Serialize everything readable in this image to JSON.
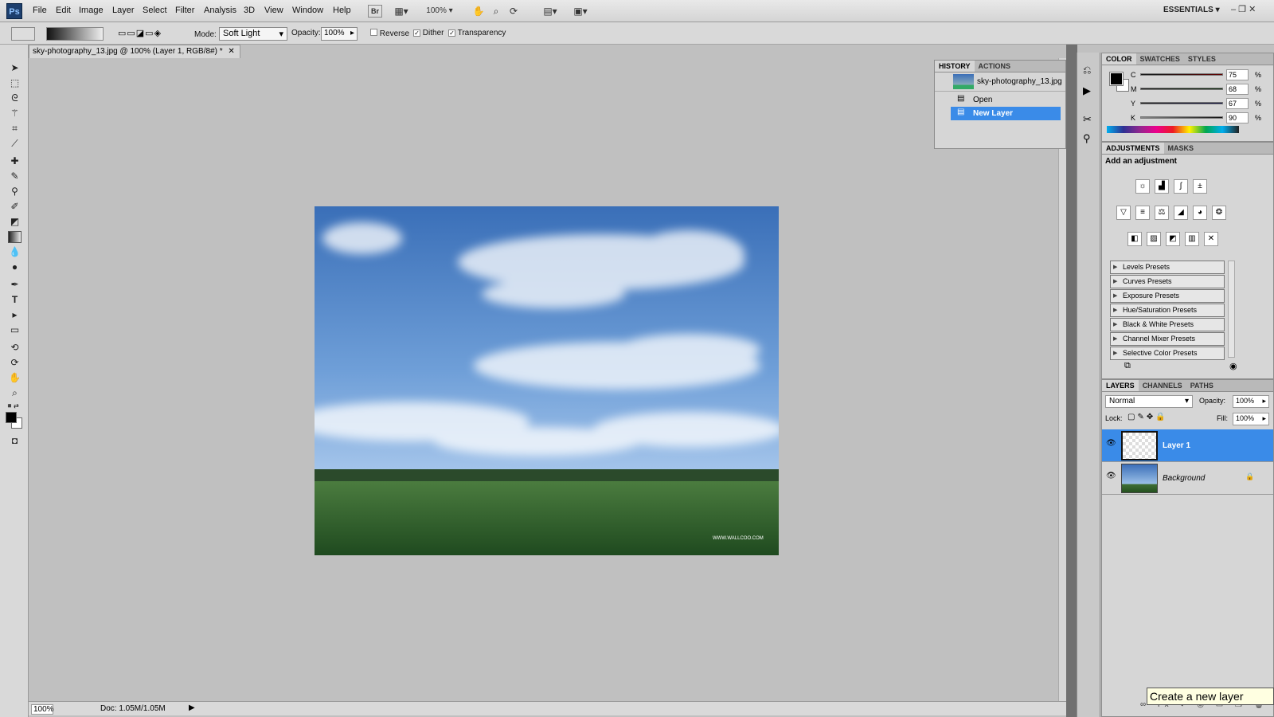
{
  "app": {
    "logo": "Ps",
    "workspace": "ESSENTIALS"
  },
  "menu": [
    "File",
    "Edit",
    "Image",
    "Layer",
    "Select",
    "Filter",
    "Analysis",
    "3D",
    "View",
    "Window",
    "Help"
  ],
  "toolbar": {
    "bridge": "Br",
    "zoom": "100%"
  },
  "options": {
    "mode_label": "Mode:",
    "mode_value": "Soft Light",
    "opacity_label": "Opacity:",
    "opacity_value": "100%",
    "reverse": "Reverse",
    "dither": "Dither",
    "transparency": "Transparency"
  },
  "document": {
    "tab_title": "sky-photography_13.jpg @ 100% (Layer 1, RGB/8#) *",
    "zoom": "100%",
    "doc_size": "Doc: 1.05M/1.05M",
    "watermark": "WWW.WALLCOO.COM"
  },
  "history": {
    "tabs": [
      "HISTORY",
      "ACTIONS"
    ],
    "snapshot": "sky-photography_13.jpg",
    "items": [
      "Open",
      "New Layer"
    ]
  },
  "color": {
    "tabs": [
      "COLOR",
      "SWATCHES",
      "STYLES"
    ],
    "channels": [
      {
        "name": "C",
        "value": "75"
      },
      {
        "name": "M",
        "value": "68"
      },
      {
        "name": "Y",
        "value": "67"
      },
      {
        "name": "K",
        "value": "90"
      }
    ],
    "unit": "%"
  },
  "adjustments": {
    "tabs": [
      "ADJUSTMENTS",
      "MASKS"
    ],
    "heading": "Add an adjustment",
    "presets": [
      "Levels Presets",
      "Curves Presets",
      "Exposure Presets",
      "Hue/Saturation Presets",
      "Black & White Presets",
      "Channel Mixer Presets",
      "Selective Color Presets"
    ]
  },
  "layers": {
    "tabs": [
      "LAYERS",
      "CHANNELS",
      "PATHS"
    ],
    "blend": "Normal",
    "opacity_label": "Opacity:",
    "opacity_value": "100%",
    "lock_label": "Lock:",
    "fill_label": "Fill:",
    "fill_value": "100%",
    "items": [
      {
        "name": "Layer 1"
      },
      {
        "name": "Background"
      }
    ]
  },
  "tooltip": "Create a new layer"
}
